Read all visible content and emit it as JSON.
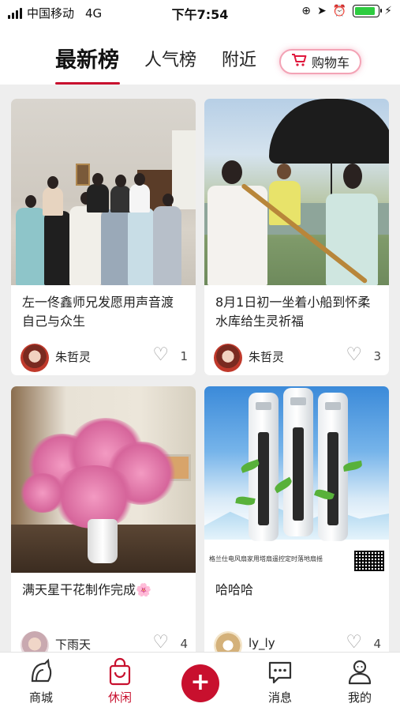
{
  "status_bar": {
    "carrier": "中国移动",
    "network": "4G",
    "time": "下午7:54",
    "battery_level": 0.9,
    "icons": [
      "signal-icon",
      "lock-rotation-icon",
      "location-icon",
      "alarm-icon",
      "battery-icon",
      "charging-icon"
    ]
  },
  "tabs": [
    {
      "label": "最新榜",
      "active": true
    },
    {
      "label": "人气榜",
      "active": false
    },
    {
      "label": "附近",
      "active": false
    }
  ],
  "cart_button": {
    "label": "购物车",
    "icon": "cart-icon"
  },
  "accent_color": "#c8102e",
  "posts": [
    {
      "title": "左一佟鑫师兄发愿用声音渡自己与众生",
      "author": "朱哲灵",
      "likes": "1",
      "image": "group-photo"
    },
    {
      "title": "8月1日初一坐着小船到怀柔水库给生灵祈福",
      "author": "朱哲灵",
      "likes": "3",
      "image": "umbrella-boat-photo"
    },
    {
      "title": "满天星干花制作完成🌸",
      "author": "下雨天",
      "likes": "4",
      "image": "baby-breath-flowers-photo"
    },
    {
      "title": "哈哈哈",
      "author": "ly_ly",
      "likes": "4",
      "image": "tower-fans-ad-photo",
      "image_caption": "格兰仕电风扇家用塔扇遥控定时落地扇摇"
    }
  ],
  "bottom_nav": [
    {
      "label": "商城",
      "icon": "store-cat-icon",
      "active": false
    },
    {
      "label": "休闲",
      "icon": "shopping-bag-icon",
      "active": true
    },
    {
      "label": "+",
      "icon": "plus-icon",
      "active": false
    },
    {
      "label": "消息",
      "icon": "message-icon",
      "active": false
    },
    {
      "label": "我的",
      "icon": "profile-icon",
      "active": false
    }
  ]
}
